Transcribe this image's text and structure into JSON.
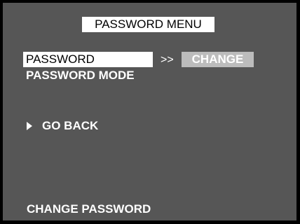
{
  "menu": {
    "title": "PASSWORD MENU",
    "items": [
      {
        "label": "PASSWORD",
        "separator": ">>",
        "value": "CHANGE"
      },
      {
        "label": "PASSWORD MODE"
      }
    ],
    "back": {
      "icon": "triangle-right-icon",
      "label": "GO BACK"
    }
  },
  "footer": {
    "help_text": "CHANGE PASSWORD"
  },
  "colors": {
    "screen_background": "#565656",
    "border": "#000000",
    "highlight": "#ffffff",
    "value_box": "#bcbcbc"
  }
}
